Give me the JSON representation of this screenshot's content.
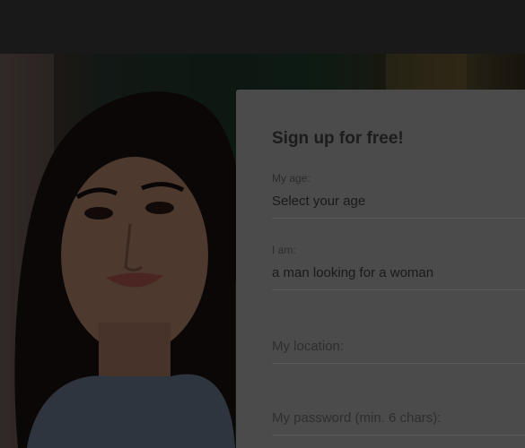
{
  "signup": {
    "title": "Sign up for free!",
    "age": {
      "label": "My age:",
      "value": "Select your age"
    },
    "gender": {
      "label": "I am:",
      "value": "a man looking for a woman"
    },
    "location": {
      "placeholder": "My location:"
    },
    "password": {
      "placeholder": "My password (min. 6 chars):"
    }
  },
  "overlay": {
    "dim_color": "#000000"
  },
  "hero": {
    "icon": "portrait-photo"
  }
}
